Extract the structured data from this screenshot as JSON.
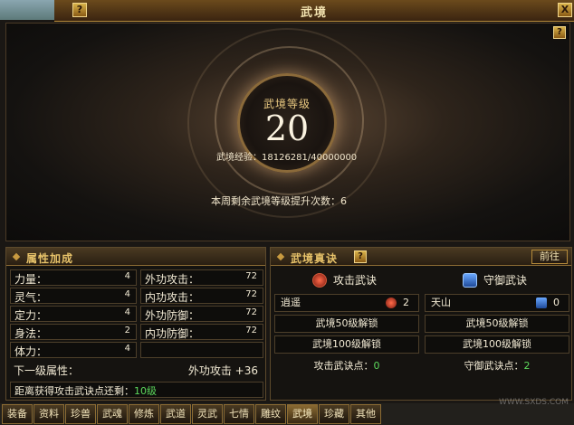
{
  "title": "武境",
  "help_glyph": "?",
  "close_glyph": "X",
  "hero": {
    "level_label": "武境等级",
    "level_value": "20",
    "exp_label": "武境经验：",
    "exp_value": "18126281/40000000",
    "weekly_label": "本周剩余武境等级提升次数：",
    "weekly_value": "6"
  },
  "attributes": {
    "header": "属性加成",
    "rows": [
      {
        "left_label": "力量：",
        "left_value": "4",
        "right_label": "外功攻击：",
        "right_value": "72"
      },
      {
        "left_label": "灵气：",
        "left_value": "4",
        "right_label": "内功攻击：",
        "right_value": "72"
      },
      {
        "left_label": "定力：",
        "left_value": "4",
        "right_label": "外功防御：",
        "right_value": "72"
      },
      {
        "left_label": "身法：",
        "left_value": "2",
        "right_label": "内功防御：",
        "right_value": "72"
      },
      {
        "left_label": "体力：",
        "left_value": "4",
        "right_label": "",
        "right_value": ""
      }
    ],
    "next_label": "下一级属性：",
    "next_value": "外功攻击 +36",
    "distance_label": "距离获得攻击武诀点还剩：",
    "distance_value": "10级"
  },
  "secrets": {
    "header": "武境真诀",
    "goto_label": "前往",
    "attack": {
      "title": "攻击武诀",
      "item_name": "逍遥",
      "item_count": "2",
      "unlock_50": "武境50级解锁",
      "unlock_100": "武境100级解锁",
      "points_label": "攻击武诀点：",
      "points_value": "0"
    },
    "defense": {
      "title": "守御武诀",
      "item_name": "天山",
      "item_count": "0",
      "unlock_50": "武境50级解锁",
      "unlock_100": "武境100级解锁",
      "points_label": "守御武诀点：",
      "points_value": "2"
    }
  },
  "tabs": [
    "装备",
    "资料",
    "珍兽",
    "武魂",
    "修炼",
    "武道",
    "灵武",
    "七情",
    "雕纹",
    "武境",
    "珍藏",
    "其他"
  ],
  "active_tab": "武境",
  "watermark": "WWW.SXDS.COM"
}
